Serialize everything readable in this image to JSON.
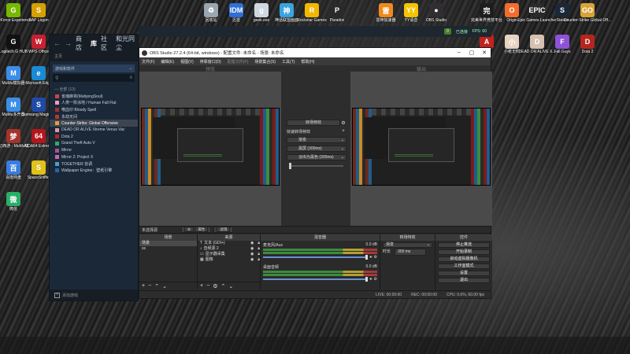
{
  "desktop": {
    "icons_left": [
      {
        "label": "GeForce Experience",
        "icon": "geforce-icon",
        "color": "#76b900",
        "glyph": "G"
      },
      {
        "label": "SAP Logon",
        "icon": "sap-logon-icon",
        "color": "#d6a100",
        "glyph": "S"
      },
      {
        "label": "Logitech G HUB",
        "icon": "logitech-ghub-icon",
        "color": "#111111",
        "glyph": "G"
      },
      {
        "label": "WPS Office",
        "icon": "wps-office-icon",
        "color": "#c8202f",
        "glyph": "W"
      },
      {
        "label": "MuMu模拟器",
        "icon": "mumu-icon",
        "color": "#3b8ee8",
        "glyph": "M"
      },
      {
        "label": "Microsoft Edge",
        "icon": "edge-icon",
        "color": "#1a8ad4",
        "glyph": "e"
      },
      {
        "label": "MuMu多开器",
        "icon": "mumu-multi-icon",
        "color": "#3b8ee8",
        "glyph": "M"
      },
      {
        "label": "Samsung Magician",
        "icon": "samsung-magician-icon",
        "color": "#1f4aa8",
        "glyph": "S"
      },
      {
        "label": "梦幻西游 - MuMu模...",
        "icon": "mhxy-icon",
        "color": "#a3342c",
        "glyph": "梦"
      },
      {
        "label": "AIDA64 Extreme",
        "icon": "aida64-icon",
        "color": "#b4161b",
        "glyph": "64"
      },
      {
        "label": "百度网盘",
        "icon": "baidu-netdisk-icon",
        "color": "#3a7de0",
        "glyph": "百"
      },
      {
        "label": "SpaceSniffer",
        "icon": "spacesniffer-icon",
        "color": "#e0c21a",
        "glyph": "S"
      },
      {
        "label": "微信",
        "icon": "wechat-icon",
        "color": "#2aae67",
        "glyph": "微"
      }
    ],
    "icons_top": [
      {
        "label": "回收站",
        "icon": "recycle-bin-icon",
        "color": "#9aa7b3",
        "glyph": "♻"
      },
      {
        "label": "迅雷",
        "icon": "xunlei-icon",
        "color": "#2f6fd6",
        "glyph": "IDM"
      },
      {
        "label": "geek.exe",
        "icon": "geek-icon",
        "color": "#cfd8e0",
        "glyph": "g"
      },
      {
        "label": "神话联盟画面",
        "icon": "game-app-icon",
        "color": "#3aa4e0",
        "glyph": "神"
      },
      {
        "label": "Rockstar Games",
        "icon": "rockstar-icon",
        "color": "#f3b700",
        "glyph": "R"
      },
      {
        "label": "Paradox",
        "icon": "paradox-icon",
        "color": "#2a2a2a",
        "glyph": "P"
      },
      {
        "label": "雷神加速器",
        "icon": "leishen-icon",
        "color": "#f08a1c",
        "glyph": "雷"
      },
      {
        "label": "YY语音",
        "icon": "yy-icon",
        "color": "#f6c400",
        "glyph": "YY"
      },
      {
        "label": "OBS Studio",
        "icon": "obs-icon",
        "color": "#302e31",
        "glyph": "●"
      }
    ],
    "icons_right": [
      {
        "label": "完美世界竞技平台",
        "icon": "perfect-world-icon",
        "color": "#1d1d1d",
        "glyph": "完"
      },
      {
        "label": "Origin",
        "icon": "origin-icon",
        "color": "#f56c2d",
        "glyph": "O"
      },
      {
        "label": "Epic Games Launcher",
        "icon": "epic-icon",
        "color": "#2a2a2a",
        "glyph": "EPIC"
      },
      {
        "label": "Steam",
        "icon": "steam-icon",
        "color": "#1b2838",
        "glyph": "S"
      },
      {
        "label": "Counter-Strike Global Off...",
        "icon": "csgo-icon",
        "color": "#d8a43a",
        "glyph": "GO"
      },
      {
        "label": "",
        "icon": "apex-icon",
        "color": "#c0231f",
        "glyph": "A"
      },
      {
        "label": "小枪无料",
        "icon": "anime-game-icon",
        "color": "#e6d3c2",
        "glyph": "小"
      },
      {
        "label": "DEAD OR ALIVE X...",
        "icon": "doa-icon",
        "color": "#d6c1b0",
        "glyph": "D"
      },
      {
        "label": "Fall Guys",
        "icon": "fallguys-icon",
        "color": "#8d52d6",
        "glyph": "F"
      },
      {
        "label": "Dota 2",
        "icon": "dota2-icon",
        "color": "#b5261d",
        "glyph": "D"
      }
    ]
  },
  "overlay": {
    "status": "已连接",
    "fps": "FPS: 60",
    "pill": "0"
  },
  "steam": {
    "nav_items": [
      "商店",
      "库",
      "社区",
      "和光同尘"
    ],
    "subtitle": "主页",
    "filter_label": "游戏和软件",
    "category": "— 全部 (13)",
    "games": [
      {
        "name": "雀魂麻将(MahjongSoul)",
        "color": "#c44"
      },
      {
        "name": "人类一败涂地 / Human Fall Flat",
        "color": "#e9c"
      },
      {
        "name": "嗜血印 Bloody Spell",
        "color": "#933"
      },
      {
        "name": "永劫无间",
        "color": "#b33"
      },
      {
        "name": "Counter-Strike: Global Offensive",
        "color": "#d8a43a",
        "selected": true
      },
      {
        "name": "DEAD OR ALIVE Xtreme Venus Vac",
        "color": "#d9a"
      },
      {
        "name": "Dota 2",
        "color": "#b5261d"
      },
      {
        "name": "Grand Theft Auto V",
        "color": "#3a6"
      },
      {
        "name": "Mirror",
        "color": "#a58"
      },
      {
        "name": "Mirror 2: Project X",
        "color": "#c6a"
      },
      {
        "name": "TOGETHER 协调",
        "color": "#59c"
      },
      {
        "name": "Wallpaper Engine：壁纸引擎",
        "color": "#26a"
      }
    ],
    "footer": "添加游戏"
  },
  "obs": {
    "title": "OBS Studio 27.2.4 (64-bit, windows) - 配置文件: 未命名 - 场景: 未命名",
    "menu": [
      "文件(F)",
      "编辑(E)",
      "视图(V)",
      "停靠窗口(D)",
      "配置文件(P)",
      "场景集合(S)",
      "工具(T)",
      "帮助(H)"
    ],
    "menu_dim": [
      4
    ],
    "preview_label": "预览",
    "program_label": "输出",
    "transition": {
      "button": "转场特效",
      "quick_label": "快速转场特效",
      "items": [
        "渐变",
        "黑屏 (300ms)",
        "淡出为黑色 (300ms)"
      ]
    },
    "srcbar": {
      "label": "未选择源",
      "props": "属性",
      "filters": "滤镜"
    },
    "scenes": {
      "title": "场景",
      "items": [
        "场景",
        "ss"
      ]
    },
    "sources": {
      "title": "来源",
      "items": [
        {
          "name": "文本 (GDI+)",
          "icon": "text-icon"
        },
        {
          "name": "音频源 2",
          "icon": "audio-icon"
        },
        {
          "name": "显示器采集",
          "icon": "monitor-icon"
        },
        {
          "name": "图像",
          "icon": "image-icon"
        }
      ]
    },
    "mixer": {
      "title": "混音器",
      "channels": [
        {
          "name": "麦克风/Aux",
          "db": "0.0 dB"
        },
        {
          "name": "桌面音频",
          "db": "0.0 dB"
        }
      ]
    },
    "transitions_dock": {
      "title": "转场特效",
      "type": "渐变",
      "duration_label": "时长",
      "duration": "300 ms"
    },
    "controls": {
      "title": "控件",
      "buttons": [
        "停止推流",
        "开始录制",
        "启动虚拟摄像机",
        "工作室模式",
        "设置",
        "退出"
      ]
    },
    "status": {
      "live": "LIVE: 00:00:00",
      "rec": "REC: 00:00:00",
      "cpu": "CPU: 0.6%, 60.00 fps"
    }
  },
  "colors": {
    "steam_bg": "#1b2838",
    "obs_bg": "#2d2d2d",
    "accent": "#6b8fd1"
  }
}
